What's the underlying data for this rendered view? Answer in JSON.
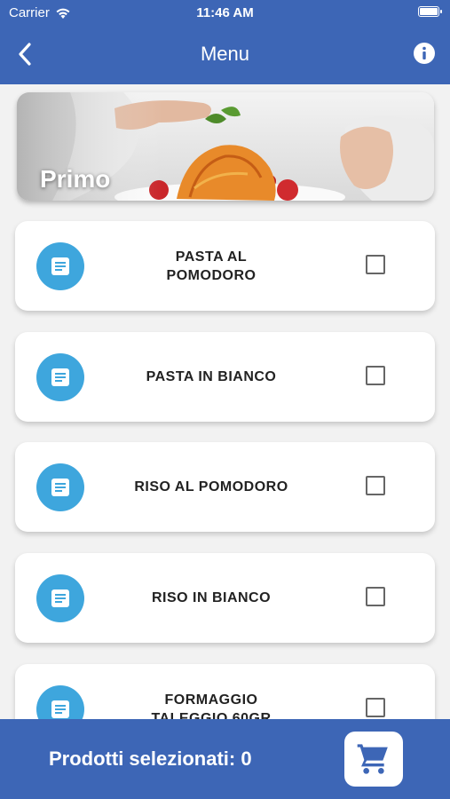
{
  "status_bar": {
    "carrier": "Carrier",
    "time": "11:46 AM"
  },
  "nav": {
    "title": "Menu"
  },
  "banner": {
    "title": "Primo"
  },
  "items": [
    {
      "label": "PASTA AL\nPOMODORO",
      "checked": false
    },
    {
      "label": "PASTA IN BIANCO",
      "checked": false
    },
    {
      "label": "RISO AL POMODORO",
      "checked": false
    },
    {
      "label": "RISO IN BIANCO",
      "checked": false
    },
    {
      "label": "FORMAGGIO\nTALEGGIO 60GR",
      "checked": false
    }
  ],
  "footer": {
    "selected_label": "Prodotti selezionati: 0"
  },
  "icons": {
    "back": "chevron-left-icon",
    "info": "info-icon",
    "item": "document-icon",
    "cart": "cart-icon"
  },
  "colors": {
    "primary": "#3d66b6",
    "icon_circle": "#3ea6dd",
    "cart_icon": "#3d66b6"
  }
}
